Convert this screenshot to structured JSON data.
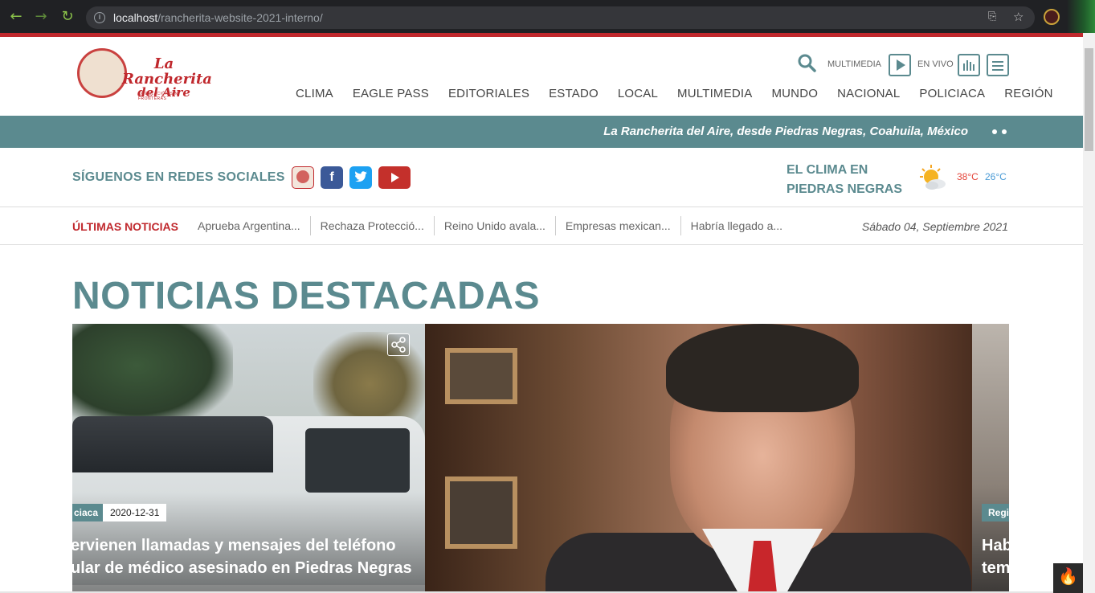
{
  "browser": {
    "url_host": "localhost",
    "url_path": "/rancherita-website-2021-interno/"
  },
  "site": {
    "brand_line1": "La",
    "brand_line2": "Rancherita",
    "brand_line3": "del Aire",
    "tagline": "LA ESTACIÓN SIN FRONTERAS",
    "accent_color": "#5b8a8f",
    "brand_red": "#c0282d"
  },
  "header": {
    "multimedia_label": "MULTIMEDIA",
    "envivo_label": "EN VIVO",
    "nav": [
      "CLIMA",
      "EAGLE PASS",
      "EDITORIALES",
      "ESTADO",
      "LOCAL",
      "MULTIMEDIA",
      "MUNDO",
      "NACIONAL",
      "POLICIACA",
      "REGIÓN"
    ]
  },
  "ticker": {
    "text": "La Rancherita del Aire, desde Piedras Negras, Coahuila, México"
  },
  "social": {
    "title": "SÍGUENOS EN REDES SOCIALES",
    "facebook": "f"
  },
  "weather": {
    "title_line1": "EL CLIMA EN",
    "title_line2": "PIEDRAS NEGRAS",
    "max": "38°C",
    "min": "26°C"
  },
  "last_news": {
    "label": "ÚLTIMAS NOTICIAS",
    "items": [
      "Aprueba Argentina...",
      "Rechaza Protecció...",
      "Reino Unido avala...",
      "Empresas mexican...",
      "Habría llegado a..."
    ],
    "date": "Sábado 04, Septiembre 2021"
  },
  "featured": {
    "title": "NOTICIAS DESTACADAS",
    "slides": [
      {
        "category": "ciaca",
        "date": "2020-12-31",
        "headline_line1": "ervienen llamadas y mensajes del teléfono",
        "headline_line2": "ular de médico asesinado en Piedras Negras"
      },
      {
        "category": "Regi",
        "headline_line1": "Hab",
        "headline_line2": "tem"
      }
    ]
  }
}
